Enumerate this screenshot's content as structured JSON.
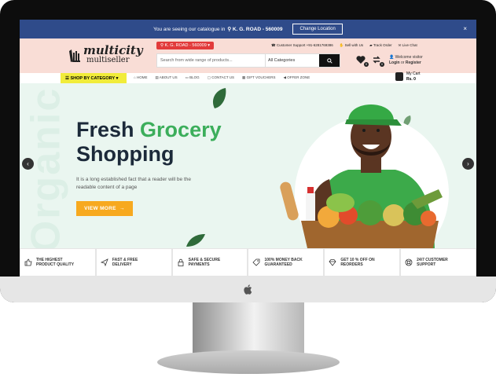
{
  "topbar": {
    "text_before": "You are seeing our catalogue in",
    "location": "K. G. ROAD - 560009",
    "change_location_label": "Change Location",
    "close_label": "×"
  },
  "header": {
    "logo_line1": "multicity",
    "logo_line2": "multiseller",
    "location_pill": "K. G. ROAD - 560009",
    "search_placeholder": "Search from wide range of products...",
    "category_value": "All Categories",
    "links": [
      "Customer Support +91-6281769386",
      "Sell with Us",
      "Track Order",
      "Live Chat"
    ],
    "welcome_line1": "Welcome visitor",
    "login_label": "Login",
    "or_label": "or",
    "register_label": "Register",
    "wishlist_count": "0",
    "compare_count": "0"
  },
  "nav": {
    "shop_by_category": "SHOP BY CATEGORY",
    "links": [
      "HOME",
      "ABOUT US",
      "BLOG",
      "CONTACT US",
      "GIFT VOUCHERS",
      "OFFER ZONE"
    ],
    "cart_label": "My Cart",
    "cart_amount": "Rs. 0"
  },
  "hero": {
    "watermark": "Organic",
    "title_part1": "Fresh",
    "title_part2": "Grocery",
    "title_line2": "Shopping",
    "description": "It is a long established fact that a reader will be the readable content of a page",
    "cta_label": "VIEW MORE"
  },
  "features": [
    {
      "line1": "THE HIGHEST",
      "line2": "PRODUCT QUALITY",
      "icon": "thumbs-up-icon"
    },
    {
      "line1": "FAST & FREE",
      "line2": "DELIVERY",
      "icon": "paper-plane-icon"
    },
    {
      "line1": "SAFE & SECURE",
      "line2": "PAYMENTS",
      "icon": "lock-icon"
    },
    {
      "line1": "100% MONEY BACK",
      "line2": "GUARANTEED",
      "icon": "money-tag-icon"
    },
    {
      "line1": "GET 10 % OFF ON",
      "line2": "REORDERS",
      "icon": "diamond-icon"
    },
    {
      "line1": "24/7 CUSTOMER",
      "line2": "SUPPORT",
      "icon": "support-icon"
    }
  ],
  "colors": {
    "topbar": "#2f4b8a",
    "header_bg": "#f9ddd6",
    "accent_green": "#3cae5b",
    "cta_orange": "#f7a91f",
    "category_yellow": "#f1ec3a",
    "location_red": "#e23b3b"
  }
}
